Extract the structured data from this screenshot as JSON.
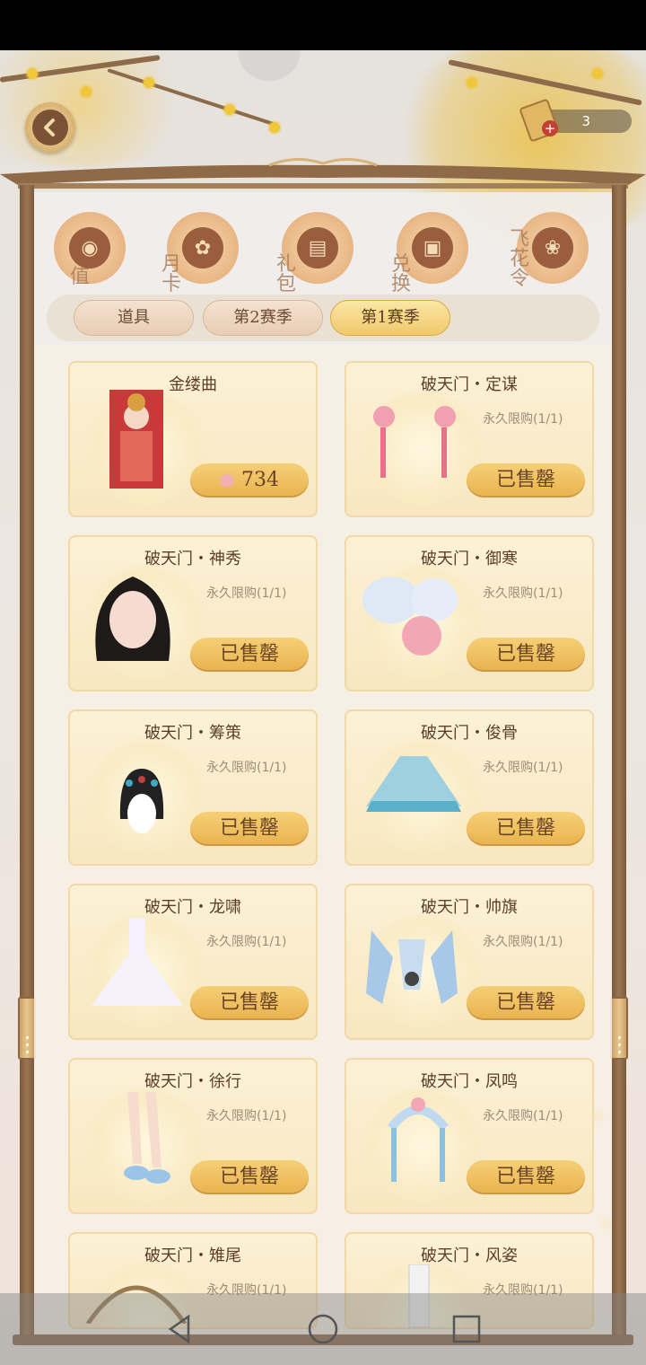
{
  "header": {
    "currency_count": "3"
  },
  "categories": [
    {
      "label": "值",
      "icon": "coin-icon"
    },
    {
      "label": "月卡",
      "icon": "card-icon"
    },
    {
      "label": "礼包",
      "icon": "gift-icon"
    },
    {
      "label": "兑换",
      "icon": "box-icon"
    },
    {
      "label": "飞花令",
      "icon": "scroll-icon"
    }
  ],
  "tabs": [
    {
      "label": "道具",
      "active": false
    },
    {
      "label": "第2赛季",
      "active": false
    },
    {
      "label": "第1赛季",
      "active": true
    }
  ],
  "items": [
    {
      "title": "金缕曲",
      "limit": "",
      "button": "734",
      "is_price": true
    },
    {
      "title": "破天门・定谋",
      "limit": "永久限购(1/1)",
      "button": "已售罄",
      "is_price": false
    },
    {
      "title": "破天门・神秀",
      "limit": "永久限购(1/1)",
      "button": "已售罄",
      "is_price": false
    },
    {
      "title": "破天门・御寒",
      "limit": "永久限购(1/1)",
      "button": "已售罄",
      "is_price": false
    },
    {
      "title": "破天门・筹策",
      "limit": "永久限购(1/1)",
      "button": "已售罄",
      "is_price": false
    },
    {
      "title": "破天门・俊骨",
      "limit": "永久限购(1/1)",
      "button": "已售罄",
      "is_price": false
    },
    {
      "title": "破天门・龙啸",
      "limit": "永久限购(1/1)",
      "button": "已售罄",
      "is_price": false
    },
    {
      "title": "破天门・帅旗",
      "limit": "永久限购(1/1)",
      "button": "已售罄",
      "is_price": false
    },
    {
      "title": "破天门・徐行",
      "limit": "永久限购(1/1)",
      "button": "已售罄",
      "is_price": false
    },
    {
      "title": "破天门・凤鸣",
      "limit": "永久限购(1/1)",
      "button": "已售罄",
      "is_price": false
    },
    {
      "title": "破天门・雉尾",
      "limit": "永久限购(1/1)",
      "button": "",
      "is_price": false
    },
    {
      "title": "破天门・风姿",
      "limit": "永久限购(1/1)",
      "button": "",
      "is_price": false
    }
  ]
}
